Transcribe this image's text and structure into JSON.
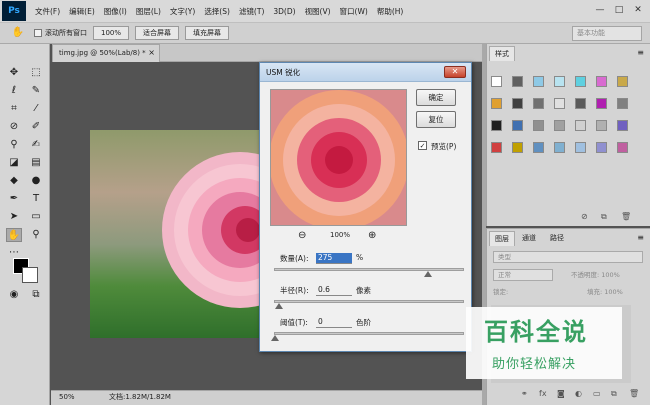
{
  "app": {
    "logo": "Ps"
  },
  "menu": [
    "文件(F)",
    "编辑(E)",
    "图像(I)",
    "图层(L)",
    "文字(Y)",
    "选择(S)",
    "滤镜(T)",
    "3D(D)",
    "视图(V)",
    "窗口(W)",
    "帮助(H)"
  ],
  "window_controls": {
    "minimize": "—",
    "restore": "□",
    "close": "✕"
  },
  "options_bar": {
    "scroll_all_label": "滚动所有窗口",
    "zoom_value": "100%",
    "fit_screen": "适合屏幕",
    "fill_screen": "填充屏幕",
    "workspace": "基本功能"
  },
  "document": {
    "tab_title": "timg.jpg @ 50%(Lab/8) *",
    "tab_close": "×",
    "zoom": "50%",
    "info": "文档:1.82M/1.82M"
  },
  "dialog": {
    "title": "USM 锐化",
    "close_glyph": "✕",
    "ok": "确定",
    "reset": "复位",
    "preview_label": "预览(P)",
    "preview_checked": "✓",
    "zoom_out": "⊖",
    "zoom_in": "⊕",
    "zoom_percent": "100%",
    "amount": {
      "label": "数量(A):",
      "value": "275",
      "unit": "%",
      "slider": 0.84
    },
    "radius": {
      "label": "半径(R):",
      "value": "0.6",
      "unit": "像素",
      "slider": 0.02
    },
    "threshold": {
      "label": "阈值(T):",
      "value": "0",
      "unit": "色阶",
      "slider": 0.0
    }
  },
  "styles_panel": {
    "tab": "样式",
    "menu_glyph": "≡",
    "swatches": [
      "#ffffff",
      "#606060",
      "#8ec9e6",
      "#b8e3f0",
      "#5fd0e0",
      "#d86bd0",
      "#c9a94a",
      "#e0a030",
      "#404040",
      "#707070",
      "#e0e0e0",
      "#5a5a5a",
      "#b020b0",
      "#808080",
      "#202020",
      "#4070b0",
      "#909090",
      "#a0a0a0",
      "#d0d0d0",
      "#b0b0b0",
      "#7060c0",
      "#d04040",
      "#c0a000",
      "#6090c0",
      "#80b0d0",
      "#a0c0e0",
      "#9090d0",
      "#c060a0"
    ],
    "footer_icons": [
      "⊘",
      "⧉",
      "🗑"
    ]
  },
  "layers_panel": {
    "tabs": [
      "图层",
      "通道",
      "路径"
    ],
    "menu_glyph": "≡",
    "kind_label": "类型",
    "blend_mode": "正常",
    "opacity": "不透明度: 100%",
    "lock_label": "锁定:",
    "fill": "填充: 100%",
    "footer_icons": [
      "⚭",
      "fx",
      "◙",
      "◐",
      "▭",
      "⧉",
      "🗑"
    ]
  },
  "watermark": {
    "title": "百科全说",
    "subtitle": "助你轻松解决"
  }
}
